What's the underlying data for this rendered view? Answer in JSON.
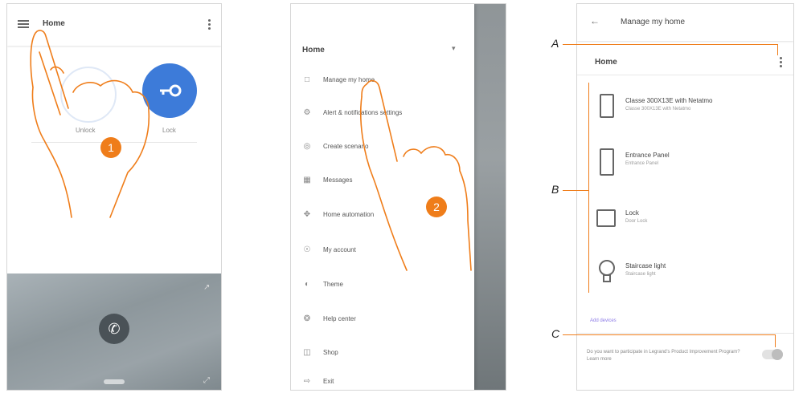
{
  "screen1": {
    "title": "Home",
    "buttons": [
      {
        "label": "Unlock",
        "color": "#ffffff"
      },
      {
        "label": "Lock",
        "color": "#3d7bd9"
      }
    ],
    "step": "1",
    "icons": {
      "menu": "hamburger-icon",
      "more": "kebab-icon",
      "call": "phone-icon"
    }
  },
  "screen2": {
    "drawer_title": "Home",
    "step": "2",
    "menu_items": [
      {
        "label": "Manage my home",
        "icon": "home-icon"
      },
      {
        "label": "Alert & notifications settings",
        "icon": "bell-icon"
      },
      {
        "label": "Create scenario",
        "icon": "gear-icon"
      },
      {
        "label": "Messages",
        "icon": "message-icon"
      },
      {
        "label": "Home automation",
        "icon": "network-icon"
      },
      {
        "label": "My account",
        "icon": "user-icon"
      },
      {
        "label": "Theme",
        "icon": "theme-icon"
      },
      {
        "label": "Help center",
        "icon": "help-icon"
      },
      {
        "label": "Shop",
        "icon": "shop-icon"
      },
      {
        "label": "Exit",
        "icon": "logout-icon"
      }
    ]
  },
  "screen3": {
    "title": "Manage my home",
    "section": "Home",
    "devices": [
      {
        "name": "Classe 300X13E with Netatmo",
        "sub": "Classe 300X13E with Netatmo",
        "icon": "videophone-icon"
      },
      {
        "name": "Entrance Panel",
        "sub": "Entrance Panel",
        "icon": "entrance-panel-icon"
      },
      {
        "name": "Lock",
        "sub": "Door Lock",
        "icon": "lock-icon"
      },
      {
        "name": "Staircase light",
        "sub": "Staircase light",
        "icon": "bulb-icon"
      }
    ],
    "link": "Add devices",
    "footer_text": "Do you want to participate in Legrand's Product Improvement Program? Learn more",
    "callouts": [
      "A",
      "B",
      "C"
    ]
  },
  "colors": {
    "accent": "#ef7d1a",
    "blue": "#3d7bd9"
  }
}
